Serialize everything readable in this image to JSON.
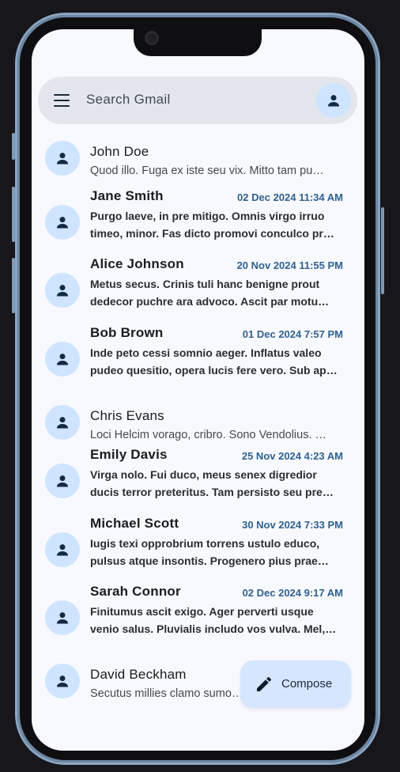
{
  "search": {
    "placeholder": "Search Gmail"
  },
  "fab": {
    "label": "Compose"
  },
  "emails": [
    {
      "sender": "John Doe",
      "date": "",
      "unread": false,
      "lines": [
        "Quod illo. Fuga ex iste seu vix. Mitto tam pu…"
      ]
    },
    {
      "sender": "Jane Smith",
      "date": "02 Dec 2024 11:34 AM",
      "unread": true,
      "lines": [
        "Purgo laeve, in pre mitigo. Omnis virgo irruo",
        "timeo, minor. Fas dicto promovi conculco pr…"
      ]
    },
    {
      "sender": "Alice Johnson",
      "date": "20 Nov 2024 11:55 PM",
      "unread": true,
      "lines": [
        "Metus secus. Crinis tuli hanc benigne prout",
        "dedecor puchre ara advoco. Ascit par motu…"
      ]
    },
    {
      "sender": "Bob Brown",
      "date": "01 Dec 2024 7:57 PM",
      "unread": true,
      "lines": [
        "Inde peto cessi somnio aeger. Inflatus valeo",
        "pudeo quesitio, opera lucis fere vero. Sub ap…"
      ]
    },
    {
      "sender": "Chris Evans",
      "date": "",
      "unread": false,
      "lines": [
        "Loci Helcim vorago, cribro. Sono Vendolius. …"
      ]
    },
    {
      "sender": "Emily Davis",
      "date": "25 Nov 2024 4:23 AM",
      "unread": true,
      "lines": [
        "Virga nolo. Fui duco, meus senex digredior",
        "ducis terror preteritus. Tam persisto seu pre…"
      ]
    },
    {
      "sender": "Michael Scott",
      "date": "30 Nov 2024 7:33 PM",
      "unread": true,
      "lines": [
        "Iugis texi opprobrium torrens ustulo educo,",
        "pulsus atque insontis. Progenero pius prae…"
      ]
    },
    {
      "sender": "Sarah Connor",
      "date": "02 Dec 2024 9:17 AM",
      "unread": true,
      "lines": [
        "Finitumus ascit exigo. Ager perverti usque",
        "venio salus. Pluvialis includo vos vulva. Mel,…"
      ]
    },
    {
      "sender": "David Beckham",
      "date": "",
      "unread": false,
      "lines": [
        "Secutus millies clamo sumo…"
      ]
    }
  ],
  "icons": {
    "menu": "menu-icon",
    "account": "person-icon",
    "avatar": "person-icon",
    "compose": "pencil-icon"
  },
  "colors": {
    "background": "#f8f9ff",
    "avatar_bg": "#cfe4ff",
    "date": "#30618f",
    "fab_bg": "#d6e6ff"
  }
}
